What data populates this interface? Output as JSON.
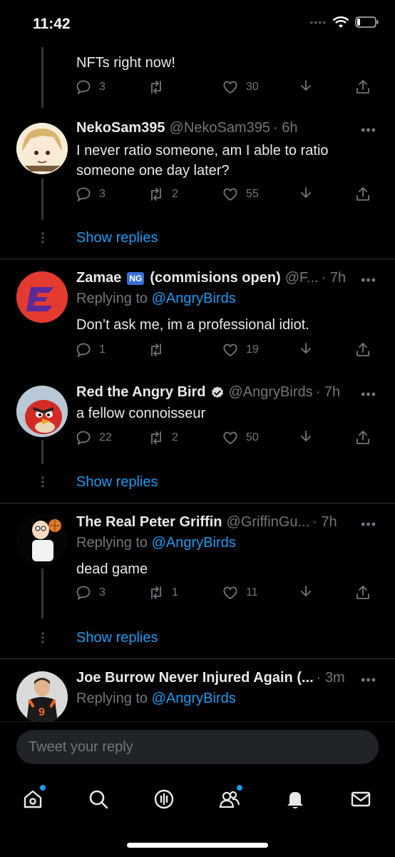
{
  "status_bar": {
    "time": "11:42"
  },
  "top_partial": {
    "text": "NFTs right now!",
    "replies": "3",
    "retweets": "",
    "likes": "30"
  },
  "tweets": [
    {
      "name": "NekoSam395",
      "handle": "@NekoSam395",
      "time": "· 6h",
      "text": "I never ratio someone, am I able to ratio someone one day later?",
      "replies": "3",
      "retweets": "2",
      "likes": "55",
      "show_replies": "Show replies"
    },
    {
      "name": "Zamae",
      "badge": "NG",
      "name_suffix": "(commisions open)",
      "handle": "@F...",
      "time": "· 7h",
      "replying_prefix": "Replying to",
      "replying_to": "@AngryBirds",
      "text": "Don’t ask me, im a professional idiot.",
      "replies": "1",
      "retweets": "",
      "likes": "19"
    },
    {
      "name": "Red the Angry Bird",
      "handle": "@AngryBirds",
      "time": "· 7h",
      "text": "a fellow connoisseur",
      "replies": "22",
      "retweets": "2",
      "likes": "50",
      "show_replies": "Show replies"
    },
    {
      "name": "The Real Peter Griffin",
      "handle": "@GriffinGu...",
      "time": "· 7h",
      "replying_prefix": "Replying to",
      "replying_to": "@AngryBirds",
      "text": "dead game",
      "replies": "3",
      "retweets": "1",
      "likes": "11",
      "show_replies": "Show replies"
    },
    {
      "name": "Joe Burrow Never Injured Again (...",
      "handle": "",
      "time": "· 3m",
      "replying_prefix": "Replying to",
      "replying_to": "@AngryBirds"
    }
  ],
  "composer": {
    "placeholder": "Tweet your reply"
  },
  "colors": {
    "accent": "#1d9bf0",
    "muted": "#71767b",
    "background": "#000000"
  }
}
